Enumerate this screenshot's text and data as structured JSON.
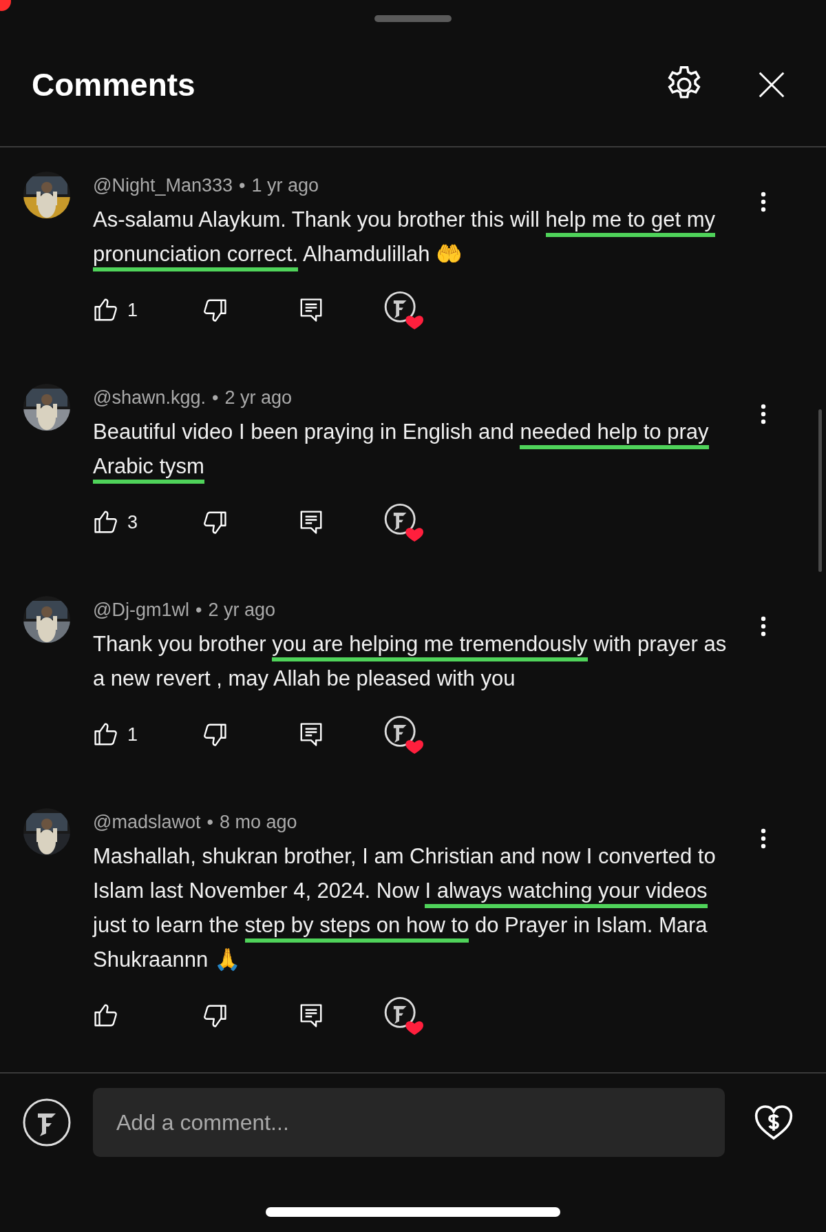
{
  "sheet": {
    "title": "Comments"
  },
  "comments": [
    {
      "author": "@Night_Man333",
      "separator": "•",
      "time": "1 yr ago",
      "avatar": {
        "kind": "picture",
        "color": "#c89a2a"
      },
      "likes": "1",
      "creator_hearted": true,
      "segments": [
        {
          "text": "As-salamu Alaykum. Thank you brother this will ",
          "underlined": false
        },
        {
          "text": "help me to get my pronunciation correct.",
          "underlined": true
        },
        {
          "text": "  Alhamdulillah 🤲",
          "underlined": false
        }
      ]
    },
    {
      "author": "@shawn.kgg.",
      "separator": "•",
      "time": "2 yr ago",
      "avatar": {
        "kind": "picture",
        "color": "#8a8f96"
      },
      "likes": "3",
      "creator_hearted": true,
      "segments": [
        {
          "text": "Beautiful video I been praying in English and ",
          "underlined": false
        },
        {
          "text": "needed help to pray Arabic tysm",
          "underlined": true
        }
      ]
    },
    {
      "author": "@Dj-gm1wl",
      "separator": "•",
      "time": "2 yr ago",
      "avatar": {
        "kind": "picture",
        "color": "#6d747c"
      },
      "likes": "1",
      "creator_hearted": true,
      "segments": [
        {
          "text": "Thank you brother ",
          "underlined": false
        },
        {
          "text": "you are helping me tremendously",
          "underlined": true
        },
        {
          "text": " with prayer as a new revert , may Allah be pleased with you",
          "underlined": false
        }
      ]
    },
    {
      "author": "@madslawot",
      "separator": "•",
      "time": "8 mo ago",
      "avatar": {
        "kind": "picture",
        "color": "#23262b"
      },
      "creator_hearted": true,
      "segments": [
        {
          "text": "Mashallah, shukran brother, I am Christian and now I converted to Islam last November 4, 2024. Now ",
          "underlined": false
        },
        {
          "text": "I always watching your videos",
          "underlined": true
        },
        {
          "text": " just to learn the ",
          "underlined": false
        },
        {
          "text": "step by steps on how to",
          "underlined": true
        },
        {
          "text": " do Prayer in Islam. Mara Shukraannn 🙏",
          "underlined": false
        }
      ]
    }
  ],
  "composer": {
    "placeholder": "Add a comment..."
  }
}
